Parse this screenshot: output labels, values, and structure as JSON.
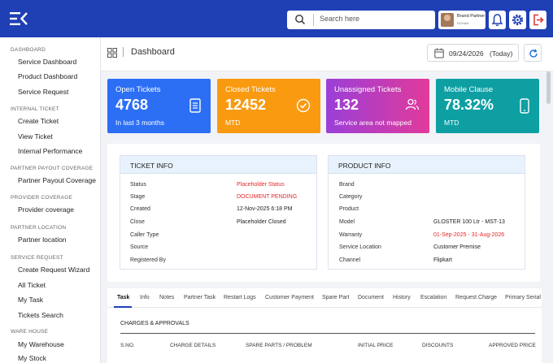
{
  "topbar": {
    "search_placeholder": "Search here",
    "user_name": "Brand Partner",
    "user_role": "ROHAN",
    "icons": [
      "menu-icon",
      "search-icon",
      "bell-icon",
      "gear-icon",
      "logout-icon"
    ],
    "colors": {
      "bar": "#1f3fb5",
      "logout": "#e03030"
    }
  },
  "sidebar": {
    "sections": [
      {
        "title": "DASHBOARD",
        "items": [
          "Service Dashboard",
          "Product Dashboard",
          "Service Request"
        ]
      },
      {
        "title": "INTERNAL TICKET",
        "items": [
          "Create Ticket",
          "View Ticket",
          "Internal Performance"
        ]
      },
      {
        "title": "PARTNER PAYOUT COVERAGE",
        "items": [
          "Partner Payout Coverage"
        ]
      },
      {
        "title": "PROVIDER COVERAGE",
        "items": [
          "Provider coverage"
        ]
      },
      {
        "title": "PARTNER LOCATION",
        "items": [
          "Partner location"
        ]
      },
      {
        "title": "SERVICE REQUEST",
        "items": [
          "Create Request Wizard",
          "All Ticket",
          "My Task",
          "Tickets Search"
        ]
      },
      {
        "title": "WARE HOUSE",
        "items": [
          "My Warehouse",
          "My Stock"
        ]
      }
    ]
  },
  "header": {
    "title": "Dashboard",
    "date": "09/24/2026",
    "date_label": "(Today)"
  },
  "cards": [
    {
      "label": "Open Tickets",
      "value": "4768",
      "sub": "In last 3 months",
      "color": "#2c6ff5",
      "icon": "document-icon"
    },
    {
      "label": "Closed Tickets",
      "value": "12452",
      "sub": "MTD",
      "color": "#f99a10",
      "icon": "check-circle-icon"
    },
    {
      "label": "Unassigned Tickets",
      "value": "132",
      "sub": "Service area not mapped",
      "color": "#b23ed0",
      "icon": "users-icon"
    },
    {
      "label": "Mobile Clause",
      "value": "78.32%",
      "sub": "MTD",
      "color": "#0e9fa3",
      "icon": "mobile-icon"
    }
  ],
  "ticket_info": {
    "title": "TICKET INFO",
    "rows": [
      {
        "label": "Status",
        "value": "Placeholder Status",
        "red": true
      },
      {
        "label": "Stage",
        "value": "DOCUMENT PENDING",
        "red": true
      },
      {
        "label": "Created",
        "value": "12-Nov-2025  6:18 PM",
        "red": false
      },
      {
        "label": "Close",
        "value": "Placeholder Closed",
        "red": false
      },
      {
        "label": "Caller Type",
        "value": "",
        "red": false
      },
      {
        "label": "Source",
        "value": "",
        "red": false
      },
      {
        "label": "Registered By",
        "value": "",
        "red": false
      }
    ]
  },
  "product_info": {
    "title": "PRODUCT INFO",
    "rows": [
      {
        "label": "Brand",
        "value": "",
        "red": false
      },
      {
        "label": "Category",
        "value": "",
        "red": false
      },
      {
        "label": "Product",
        "value": "",
        "red": false
      },
      {
        "label": "Model",
        "value": "GLOSTER 100 Ltr - MST-13",
        "red": false
      },
      {
        "label": "Warranty",
        "value": "01-Sep-2025 - 31-Aug-2026",
        "red": true
      },
      {
        "label": "Service Location",
        "value": "Customer Premise",
        "red": false
      },
      {
        "label": "Channel",
        "value": "Flipkart",
        "red": false
      }
    ]
  },
  "tabs": [
    "Task",
    "Info",
    "Notes",
    "Partner Task",
    "Restart Logs",
    "Customer Payment",
    "Spare Part",
    "Document",
    "History",
    "Escalation",
    "Request Charge",
    "Primary Serial"
  ],
  "active_tab": "Task",
  "charges": {
    "title": "CHARGES & APPROVALS",
    "columns": [
      "S.NO.",
      "CHARGE DETAILS",
      "SPARE PARTS / PROBLEM",
      "INITIAL PRICE",
      "DISCOUNTS",
      "APPROVED PRICE"
    ]
  }
}
